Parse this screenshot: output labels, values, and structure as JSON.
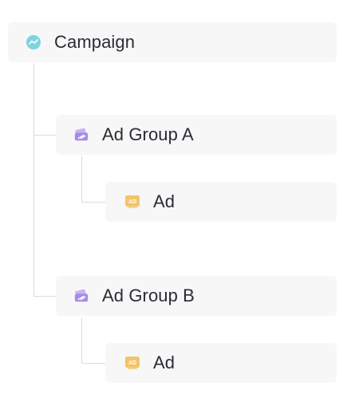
{
  "tree": {
    "campaign": {
      "label": "Campaign",
      "icon": "campaign-trend-icon",
      "icon_color": "#7fd3de"
    },
    "groups": [
      {
        "label": "Ad Group A",
        "icon": "ad-group-tag-icon",
        "icon_color": "#a98be6",
        "ad": {
          "label": "Ad",
          "icon": "ad-badge-icon",
          "icon_color": "#f2c46a"
        }
      },
      {
        "label": "Ad Group B",
        "icon": "ad-group-tag-icon",
        "icon_color": "#a98be6",
        "ad": {
          "label": "Ad",
          "icon": "ad-badge-icon",
          "icon_color": "#f2c46a"
        }
      }
    ]
  },
  "colors": {
    "node_background": "#f7f7f8",
    "connector": "#dcdce0",
    "text": "#2b2b33"
  }
}
